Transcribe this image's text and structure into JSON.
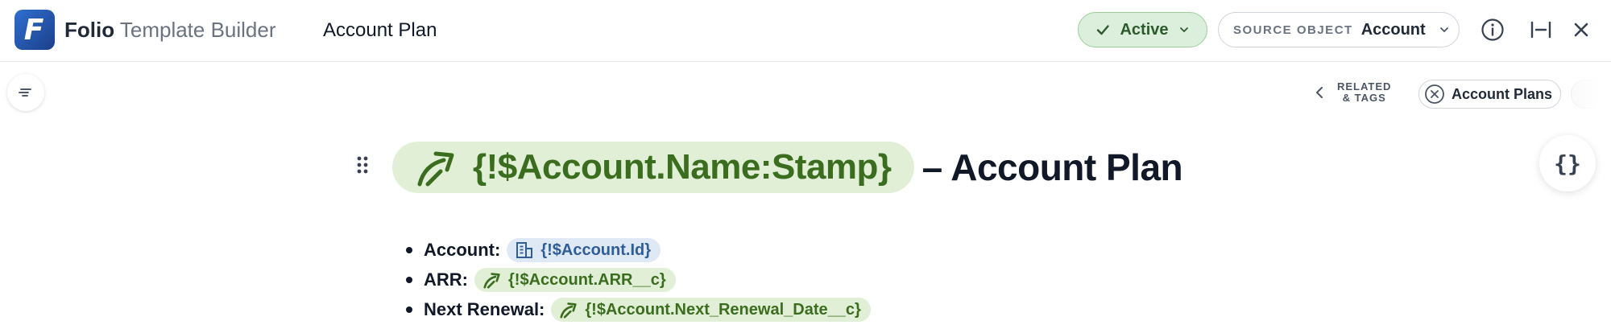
{
  "header": {
    "logo_letter": "F",
    "brand_primary": "Folio",
    "brand_secondary": "Template Builder",
    "document_title": "Account Plan",
    "status": {
      "label": "Active",
      "color": "#dcefdc"
    },
    "source_object": {
      "key": "SOURCE OBJECT",
      "value": "Account"
    }
  },
  "toolbar": {
    "related_tags_label_line1": "RELATED",
    "related_tags_label_line2": "& TAGS",
    "tag_chip_label": "Account Plans"
  },
  "document": {
    "heading_merge_field": "{!$Account.Name:Stamp}",
    "heading_suffix": "– Account Plan",
    "fields": [
      {
        "label": "Account:",
        "merge_field": "{!$Account.Id}",
        "type": "id",
        "icon": "building-icon"
      },
      {
        "label": "ARR:",
        "merge_field": "{!$Account.ARR__c}",
        "type": "field",
        "icon": "link-arrow-icon"
      },
      {
        "label": "Next Renewal:",
        "merge_field": "{!$Account.Next_Renewal_Date__c}",
        "type": "field",
        "icon": "link-arrow-icon"
      }
    ]
  },
  "colors": {
    "merge_field_bg": "#e0efd6",
    "merge_field_text": "#3b6d1f",
    "id_field_bg": "#dfe8f5",
    "id_field_text": "#2e5d97",
    "brand_blue": "#2f6fd0"
  }
}
